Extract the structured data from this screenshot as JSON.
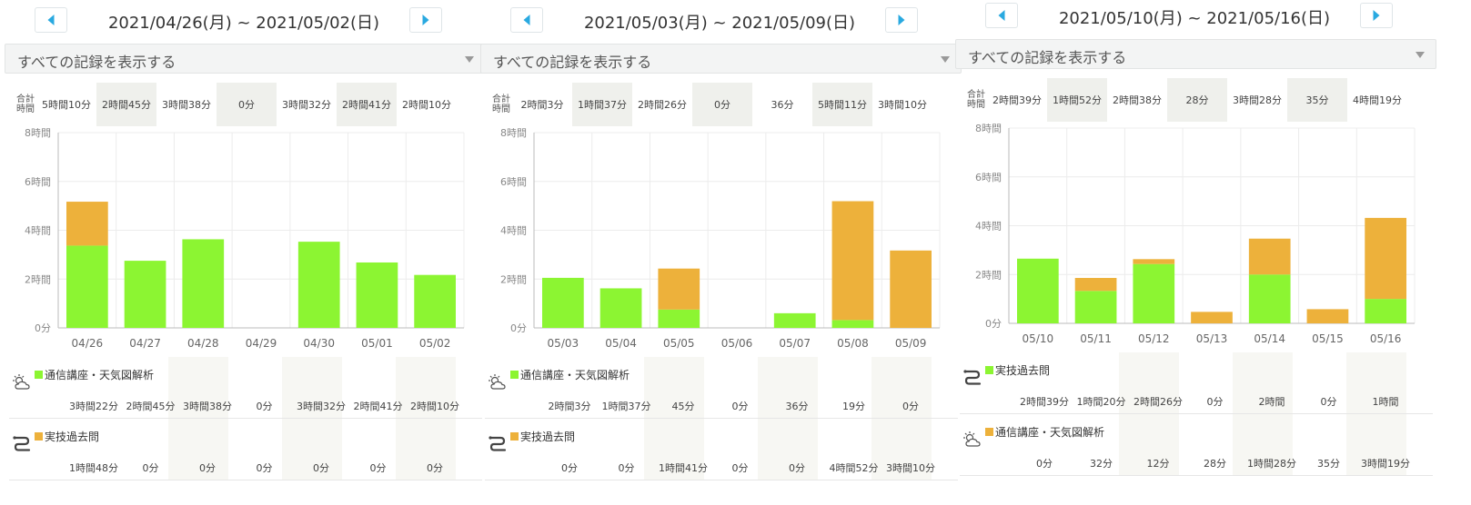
{
  "ui": {
    "filter_label": "すべての記録を表示する",
    "total_label_line1": "合計",
    "total_label_line2": "時間"
  },
  "colors": {
    "green": "#8cf532",
    "orange": "#edb13b",
    "accent": "#29a9e0"
  },
  "icons": {
    "prev": "chevron-left-icon",
    "next": "chevron-right-icon",
    "weather": "weather-icon",
    "practice": "route-icon"
  },
  "panels": [
    {
      "date_range": "2021/04/26(月) ~ 2021/05/02(日)",
      "totals": [
        "5時間10分",
        "2時間45分",
        "3時間38分",
        "0分",
        "3時間32分",
        "2時間41分",
        "2時間10分"
      ],
      "categories_rows": [
        {
          "name": "通信講座・天気図解析",
          "color": "green",
          "icon": "weather-icon",
          "values": [
            "3時間22分",
            "2時間45分",
            "3時間38分",
            "0分",
            "3時間32分",
            "2時間41分",
            "2時間10分"
          ]
        },
        {
          "name": "実技過去問",
          "color": "orange",
          "icon": "route-icon",
          "values": [
            "1時間48分",
            "0分",
            "0分",
            "0分",
            "0分",
            "0分",
            "0分"
          ]
        }
      ]
    },
    {
      "date_range": "2021/05/03(月) ~ 2021/05/09(日)",
      "totals": [
        "2時間3分",
        "1時間37分",
        "2時間26分",
        "0分",
        "36分",
        "5時間11分",
        "3時間10分"
      ],
      "categories_rows": [
        {
          "name": "通信講座・天気図解析",
          "color": "green",
          "icon": "weather-icon",
          "values": [
            "2時間3分",
            "1時間37分",
            "45分",
            "0分",
            "36分",
            "19分",
            "0分"
          ]
        },
        {
          "name": "実技過去問",
          "color": "orange",
          "icon": "route-icon",
          "values": [
            "0分",
            "0分",
            "1時間41分",
            "0分",
            "0分",
            "4時間52分",
            "3時間10分"
          ]
        }
      ]
    },
    {
      "date_range": "2021/05/10(月) ~ 2021/05/16(日)",
      "totals": [
        "2時間39分",
        "1時間52分",
        "2時間38分",
        "28分",
        "3時間28分",
        "35分",
        "4時間19分"
      ],
      "categories_rows": [
        {
          "name": "実技過去問",
          "color": "green",
          "icon": "route-icon",
          "values": [
            "2時間39分",
            "1時間20分",
            "2時間26分",
            "0分",
            "2時間",
            "0分",
            "1時間"
          ]
        },
        {
          "name": "通信講座・天気図解析",
          "color": "orange",
          "icon": "weather-icon",
          "values": [
            "0分",
            "32分",
            "12分",
            "28分",
            "1時間28分",
            "35分",
            "3時間19分"
          ]
        }
      ]
    }
  ],
  "chart_data": [
    {
      "type": "bar",
      "stacked": true,
      "categories": [
        "04/26",
        "04/27",
        "04/28",
        "04/29",
        "04/30",
        "05/01",
        "05/02"
      ],
      "y_ticks": [
        "0分",
        "2時間",
        "4時間",
        "6時間",
        "8時間"
      ],
      "ylim": [
        0,
        8
      ],
      "series": [
        {
          "name": "通信講座・天気図解析",
          "color": "#8cf532",
          "values": [
            3.37,
            2.75,
            3.63,
            0,
            3.53,
            2.68,
            2.17
          ]
        },
        {
          "name": "実技過去問",
          "color": "#edb13b",
          "values": [
            1.8,
            0,
            0,
            0,
            0,
            0,
            0
          ]
        }
      ]
    },
    {
      "type": "bar",
      "stacked": true,
      "categories": [
        "05/03",
        "05/04",
        "05/05",
        "05/06",
        "05/07",
        "05/08",
        "05/09"
      ],
      "y_ticks": [
        "0分",
        "2時間",
        "4時間",
        "6時間",
        "8時間"
      ],
      "ylim": [
        0,
        8
      ],
      "series": [
        {
          "name": "通信講座・天気図解析",
          "color": "#8cf532",
          "values": [
            2.05,
            1.62,
            0.75,
            0,
            0.6,
            0.32,
            0
          ]
        },
        {
          "name": "実技過去問",
          "color": "#edb13b",
          "values": [
            0,
            0,
            1.68,
            0,
            0,
            4.87,
            3.17
          ]
        }
      ]
    },
    {
      "type": "bar",
      "stacked": true,
      "categories": [
        "05/10",
        "05/11",
        "05/12",
        "05/13",
        "05/14",
        "05/15",
        "05/16"
      ],
      "y_ticks": [
        "0分",
        "2時間",
        "4時間",
        "6時間",
        "8時間"
      ],
      "ylim": [
        0,
        8
      ],
      "series": [
        {
          "name": "実技過去問",
          "color": "#8cf532",
          "values": [
            2.65,
            1.33,
            2.43,
            0,
            2.0,
            0,
            1.0
          ]
        },
        {
          "name": "通信講座・天気図解析",
          "color": "#edb13b",
          "values": [
            0,
            0.53,
            0.2,
            0.47,
            1.47,
            0.58,
            3.32
          ]
        }
      ]
    }
  ]
}
